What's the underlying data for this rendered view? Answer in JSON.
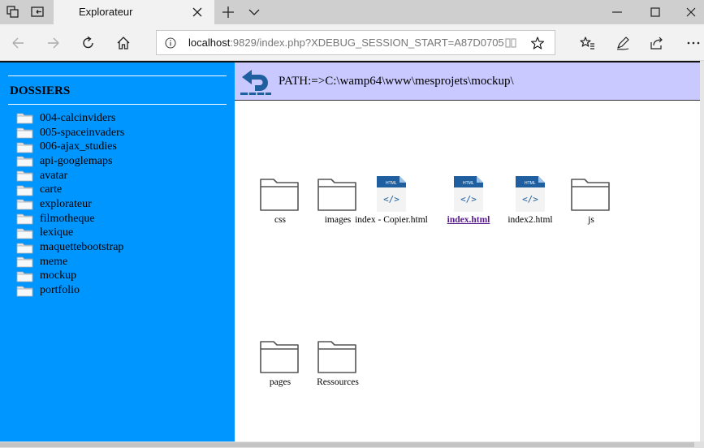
{
  "browser": {
    "tab_title": "Explorateur",
    "address": {
      "host": "localhost",
      "rest": ":9829/index.php?XDEBUG_SESSION_START=A87D0705"
    }
  },
  "sidebar": {
    "title": "DOSSIERS",
    "folders": [
      "004-calcinviders",
      "005-spaceinvaders",
      "006-ajax_studies",
      "api-googlemaps",
      "avatar",
      "carte",
      "explorateur",
      "filmotheque",
      "lexique",
      "maquettebootstrap",
      "meme",
      "mockup",
      "portfolio"
    ]
  },
  "main": {
    "path": "PATH:=>C:\\wamp64\\www\\mesprojets\\mockup\\",
    "items": [
      {
        "name": "css",
        "type": "folder",
        "active": false
      },
      {
        "name": "images",
        "type": "folder",
        "active": false
      },
      {
        "name": "index - Copier.html",
        "type": "html",
        "active": false
      },
      {
        "name": "index.html",
        "type": "html",
        "active": true
      },
      {
        "name": "index2.html",
        "type": "html",
        "active": false
      },
      {
        "name": "js",
        "type": "folder",
        "active": false
      },
      {
        "name": "pages",
        "type": "folder",
        "active": false
      },
      {
        "name": "Ressources",
        "type": "folder",
        "active": false
      }
    ],
    "html_badge": "HTML",
    "html_glyph": "</>"
  },
  "colors": {
    "sidebar": "#0096ff",
    "pathbar": "#c9c9ff",
    "html_icon": "#1f5f9f",
    "visited_link": "#551a8b"
  }
}
